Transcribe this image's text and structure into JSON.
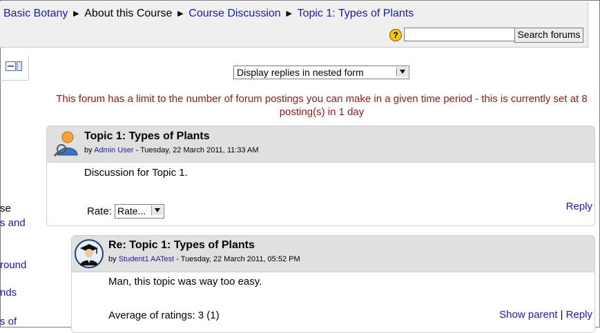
{
  "breadcrumb": {
    "items": [
      "Basic Botany",
      "About this Course",
      "Course Discussion",
      "Topic 1: Types of Plants"
    ],
    "separator": "►"
  },
  "search": {
    "help_glyph": "?",
    "value": "",
    "button_label": "Search forums"
  },
  "left_block": {
    "fragments": [
      "se",
      "s and",
      "round",
      "nds",
      "s of"
    ]
  },
  "display_mode": {
    "selected": "Display replies in nested form"
  },
  "forum_notice": "This forum has a limit to the number of forum postings you can make in a given time period - this is currently set at 8 posting(s) in 1 day",
  "posts": [
    {
      "subject": "Topic 1: Types of Plants",
      "by": "by",
      "author": "Admin User",
      "date": " - Tuesday, 22 March 2011, 11:33 AM",
      "message": "Discussion for Topic 1.",
      "rate_label": "Rate:",
      "rate_value": "Rate...",
      "reply_label": "Reply"
    },
    {
      "subject": "Re: Topic 1: Types of Plants",
      "by": "by",
      "author": "Student1 AATest",
      "date": " - Tuesday, 22 March 2011, 05:52 PM",
      "message": "Man, this topic was way too easy.",
      "rating_text": "Average of ratings: 3 (1)",
      "show_parent_label": "Show parent",
      "separator": "|",
      "reply_label": "Reply"
    }
  ],
  "colors": {
    "link": "#1a1aa8",
    "notice": "#8b1a1a",
    "post_header": "#e0e0e0",
    "navbar": "#f0f0f0"
  },
  "icons": [
    "help-icon",
    "block-dock-icon",
    "admin-avatar-icon",
    "student-avatar-icon",
    "dropdown-arrow-icon"
  ]
}
